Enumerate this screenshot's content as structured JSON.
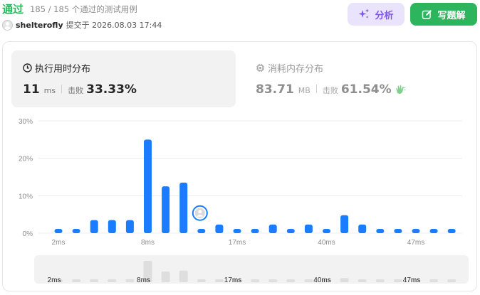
{
  "header": {
    "status": "通过",
    "summary": "185 / 185 个通过的测试用例",
    "author": "shelterofly",
    "submitted": "提交于 2026.08.03 17:44",
    "analyze_label": "分析",
    "write_label": "写题解"
  },
  "runtime": {
    "title": "执行用时分布",
    "value": "11",
    "unit": "ms",
    "beat_label": "击败",
    "beat": "33.33%",
    "icon": "clock-icon"
  },
  "memory": {
    "title": "消耗内存分布",
    "value": "83.71",
    "unit": "MB",
    "beat_label": "击败",
    "beat": "61.54%",
    "icon": "chip-icon",
    "badge_icon": "clapping-hands-icon"
  },
  "colors": {
    "accent_green": "#2db55d",
    "bar_blue": "#1a7cff",
    "analyze_purple": "#7e57e8",
    "mini_bar_gray": "#dedede"
  },
  "chart_data": {
    "type": "bar",
    "y_ticks": [
      "30%",
      "20%",
      "10%",
      "0%"
    ],
    "ylim": [
      0,
      30
    ],
    "x_tick_labels": [
      "2ms",
      "8ms",
      "17ms",
      "40ms",
      "47ms"
    ],
    "values": [
      1,
      1,
      3.5,
      3.5,
      3.5,
      25,
      12.5,
      13.5,
      1,
      2.3,
      1,
      1,
      2.3,
      1,
      2.3,
      1,
      4.8,
      2.3,
      1,
      1,
      1,
      1,
      1
    ],
    "user_bar_index": 8,
    "range_labels": [
      "2ms",
      "8ms",
      "17ms",
      "40ms",
      "47ms"
    ]
  }
}
